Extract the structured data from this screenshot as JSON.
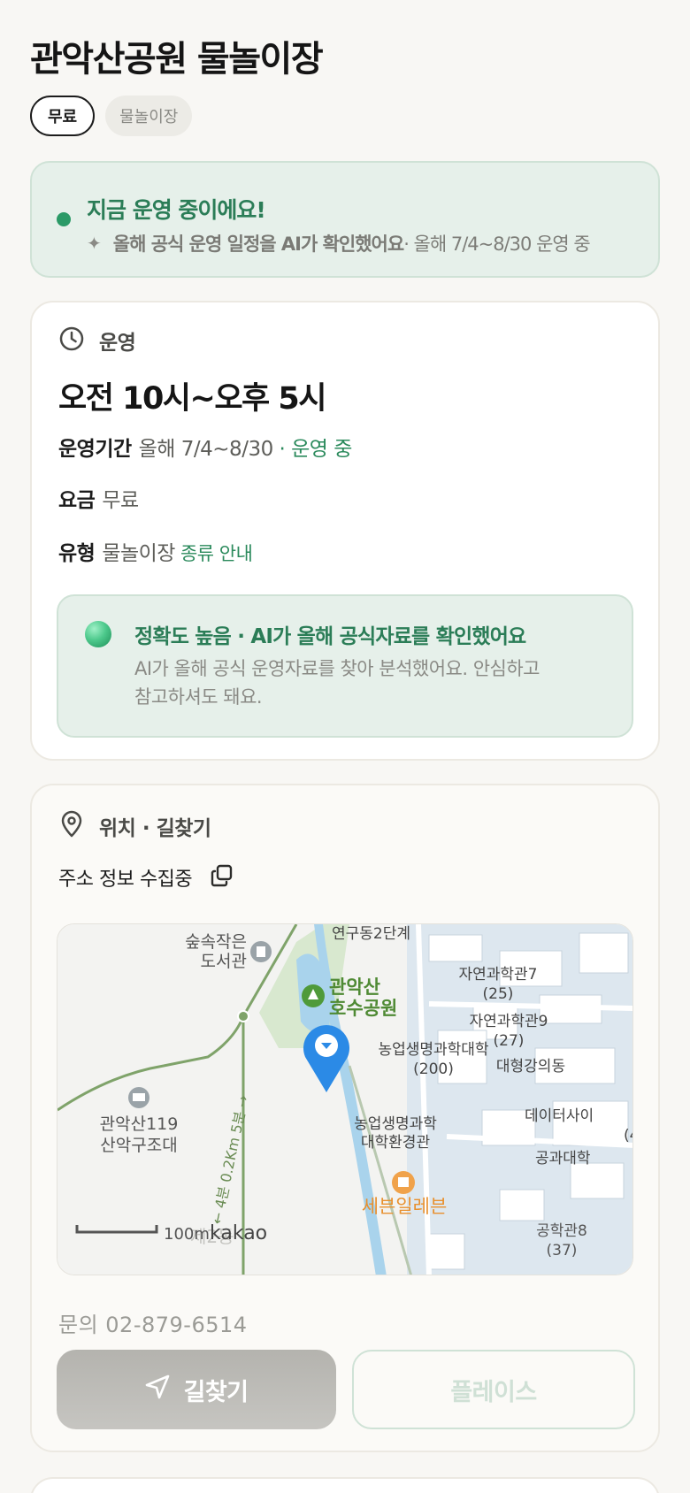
{
  "header": {
    "title": "관악산공원 물놀이장"
  },
  "tags": {
    "price": "무료",
    "category": "물놀이장"
  },
  "status_banner": {
    "headline": "지금 운영 중이에요!",
    "source_bold": "올해 공식 운영 일정을 AI가 확인했어요",
    "source_rest": " · 올해 7/4~8/30 운영 중",
    "accent_color": "#2b7d57"
  },
  "operation": {
    "section_label": "운영",
    "hours": "오전 10시~오후 5시",
    "period_label": "운영기간",
    "period_value": "올해 7/4~8/30",
    "period_status": " · 운영 중",
    "fee_label": "요금",
    "fee_value": "무료",
    "type_label": "유형",
    "type_value": "물놀이장",
    "type_link": "종류 안내",
    "accuracy": {
      "title": "정확도 높음 · AI가 올해 공식자료를 확인했어요",
      "line1": "AI가 올해 공식 운영자료를 찾아 분석했어요. 안심하고",
      "line2": "참고하셔도 돼요."
    }
  },
  "location": {
    "section_label": "위치 · 길찾기",
    "address_status": "주소 정보 수집중",
    "map": {
      "labels": {
        "library_1": "숲속작은",
        "library_2": "도서관",
        "research": "연구동2단계",
        "park_1": "관악산",
        "park_2": "호수공원",
        "science7": "자연과학관7",
        "science7_no": "(25)",
        "science9": "자연과학관9",
        "science9_no": "(27)",
        "agri": "농업생명과학대학",
        "agri_no": "(200)",
        "lecture": "대형강의동",
        "rescue_1": "관악산119",
        "rescue_2": "산악구조대",
        "agri_env_1": "농업생명과학",
        "agri_env_2": "대학환경관",
        "data": "데이터사이",
        "data_no": "(4",
        "engineering": "공과대학",
        "store": "세븐일레븐",
        "eng8": "공학관8",
        "eng8_no": "(37)",
        "trail": "← 4분 0.2Km 5분 →",
        "scale": "100m",
        "brand": "kakao",
        "faded": "제2동"
      }
    },
    "phone": "문의 02-879-6514",
    "directions_button": "길찾기",
    "place_button": "플레이스"
  }
}
